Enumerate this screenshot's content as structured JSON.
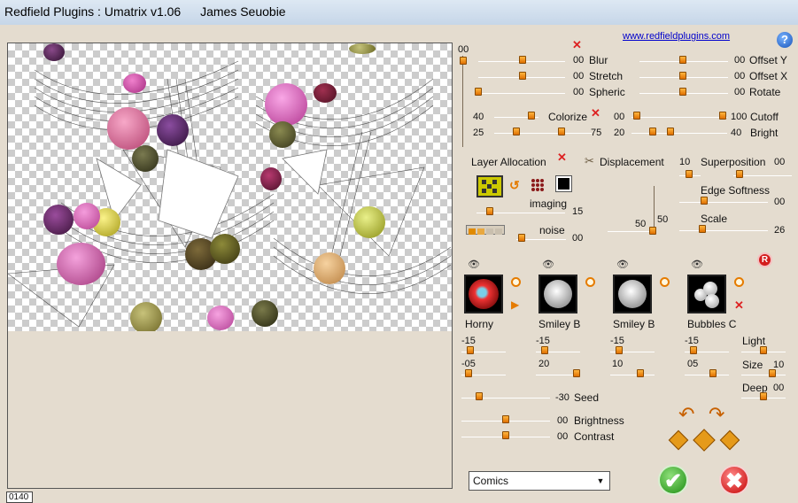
{
  "window": {
    "title_parts": [
      "Redfield Plugins : Umatrix v1.06",
      "James Seuobie"
    ]
  },
  "header": {
    "link": "www.redfieldplugins.com",
    "help": "?"
  },
  "top_slider": {
    "value": "00"
  },
  "sliders_left": [
    {
      "label": "Blur",
      "value": "00"
    },
    {
      "label": "Stretch",
      "value": "00"
    },
    {
      "label": "Spheric",
      "value": "00"
    }
  ],
  "sliders_right": [
    {
      "label": "Offset Y",
      "value": "00"
    },
    {
      "label": "Offset X",
      "value": "00"
    },
    {
      "label": "Rotate",
      "value": "00"
    }
  ],
  "colorize": {
    "label": "Colorize",
    "value": "40"
  },
  "range_a": {
    "low": "25",
    "high": "75"
  },
  "cutoff": {
    "label": "Cutoff",
    "low": "00",
    "high": "100"
  },
  "bright": {
    "label": "Bright",
    "low": "20",
    "high": "40"
  },
  "layer_allocation": {
    "label": "Layer Allocation"
  },
  "displacement": {
    "label": "Displacement"
  },
  "superposition": {
    "label": "Superposition",
    "low": "10",
    "value": "00"
  },
  "edge_softness": {
    "label": "Edge Softness",
    "value": "00"
  },
  "imaging": {
    "label": "imaging",
    "value": "15"
  },
  "noise": {
    "label": "noise",
    "value": "00"
  },
  "displacement_values": {
    "x": "50",
    "y": "50"
  },
  "scale": {
    "label": "Scale",
    "value": "26"
  },
  "thumbs": [
    {
      "name": "Horny",
      "v1": "-15",
      "v2": "-05"
    },
    {
      "name": "Smiley B",
      "v1": "-15",
      "v2": "20"
    },
    {
      "name": "Smiley B",
      "v1": "-15",
      "v2": "10"
    },
    {
      "name": "Bubbles C",
      "v1": "-15",
      "v2": "05"
    }
  ],
  "light": {
    "label": "Light"
  },
  "size": {
    "label": "Size",
    "value": "10"
  },
  "deep": {
    "label": "Deep",
    "value": "00"
  },
  "seed": {
    "label": "Seed",
    "value": "-30"
  },
  "brightness": {
    "label": "Brightness",
    "value": "00"
  },
  "contrast": {
    "label": "Contrast",
    "value": "00"
  },
  "preset": {
    "selected": "Comics"
  },
  "counter": "0140",
  "r_button": "R",
  "colors": {
    "knob": "#f28c00",
    "ok": "#1d8d12",
    "cancel": "#c40000",
    "link": "#0000cc"
  }
}
